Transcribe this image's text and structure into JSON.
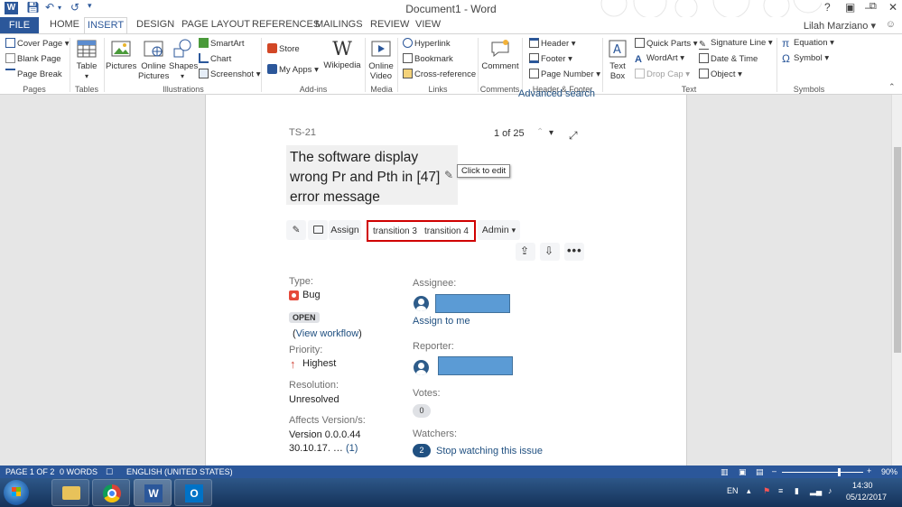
{
  "window": {
    "title": "Document1 - Word",
    "user": "Lilah Marziano"
  },
  "tabs": [
    "FILE",
    "HOME",
    "INSERT",
    "DESIGN",
    "PAGE LAYOUT",
    "REFERENCES",
    "MAILINGS",
    "REVIEW",
    "VIEW"
  ],
  "active_tab": "INSERT",
  "ribbon": {
    "pages": {
      "label": "Pages",
      "items": [
        "Cover Page",
        "Blank Page",
        "Page Break"
      ]
    },
    "tables": {
      "label": "Tables",
      "items": [
        "Table"
      ]
    },
    "illustrations": {
      "label": "Illustrations",
      "items": [
        "Pictures",
        "Online Pictures",
        "Shapes",
        "SmartArt",
        "Chart",
        "Screenshot"
      ]
    },
    "addins": {
      "label": "Add-ins",
      "items": [
        "Store",
        "My Apps",
        "Wikipedia"
      ]
    },
    "media": {
      "label": "Media",
      "items": [
        "Online Video"
      ]
    },
    "links": {
      "label": "Links",
      "items": [
        "Hyperlink",
        "Bookmark",
        "Cross-reference"
      ]
    },
    "comments": {
      "label": "Comments",
      "items": [
        "Comment"
      ]
    },
    "header_footer": {
      "label": "Header & Footer",
      "items": [
        "Header",
        "Footer",
        "Page Number"
      ]
    },
    "text": {
      "label": "Text",
      "items": [
        "Text Box",
        "Quick Parts",
        "WordArt",
        "Drop Cap",
        "Signature Line",
        "Date & Time",
        "Object"
      ]
    },
    "symbols": {
      "label": "Symbols",
      "items": [
        "Equation",
        "Symbol"
      ]
    }
  },
  "issue": {
    "advanced_search": "Advanced search",
    "key": "TS-21",
    "counter": "1 of 25",
    "title": "The software display wrong Pr and Pth in [47] error message",
    "tooltip": "Click to edit",
    "actions": {
      "assign": "Assign",
      "transition3": "transition 3",
      "transition4": "transition 4",
      "admin": "Admin"
    },
    "type_label": "Type:",
    "type_value": "Bug",
    "status": "OPEN",
    "view_workflow": "View workflow",
    "priority_label": "Priority:",
    "priority_value": "Highest",
    "resolution_label": "Resolution:",
    "resolution_value": "Unresolved",
    "affects_label": "Affects Version/s:",
    "affects_value_1": "Version 0.0.0.44",
    "affects_value_2": "30.10.17.",
    "affects_more": "(1)",
    "assignee_label": "Assignee:",
    "assign_to_me": "Assign to me",
    "reporter_label": "Reporter:",
    "votes_label": "Votes:",
    "votes_count": "0",
    "watchers_label": "Watchers:",
    "watchers_count": "2",
    "stop_watching": "Stop watching this issue"
  },
  "statusbar": {
    "page": "PAGE 1 OF 2",
    "words": "0 WORDS",
    "language": "ENGLISH (UNITED STATES)",
    "zoom": "90%",
    "zoom_fraction": 0.7
  },
  "taskbar": {
    "lang": "EN",
    "time": "14:30",
    "date": "05/12/2017"
  },
  "colors": {
    "word_blue": "#2b579a",
    "jira_link": "#205081",
    "highlight_red": "#d00000",
    "redacted_blue": "#5b9bd5"
  }
}
